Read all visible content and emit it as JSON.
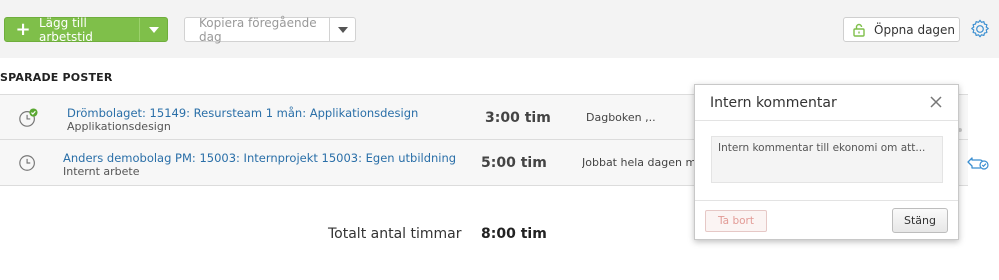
{
  "toolbar": {
    "add_label": "Lägg till arbetstid",
    "copy_label": "Kopiera föregående dag",
    "open_label": "Öppna dagen"
  },
  "section_title": "SPARADE POSTER",
  "entries": [
    {
      "title": "Drömbolaget: 15149: Resursteam 1 mån: Applikationsdesign",
      "subtitle": "Applikationsdesign",
      "hours": "3:00 tim",
      "note": "Dagboken ,..",
      "status": "completed"
    },
    {
      "title": "Anders demobolag PM: 15003: Internprojekt 15003: Egen utbildning",
      "subtitle": "Internt arbete",
      "hours": "5:00 tim",
      "note": "Jobbat hela dagen med",
      "status": "pending"
    }
  ],
  "totals": {
    "label": "Totalt antal timmar",
    "value": "8:00 tim"
  },
  "popup": {
    "title": "Intern kommentar",
    "comment": "Intern kommentar till ekonomi om att...",
    "delete_label": "Ta bort",
    "close_label": "Stäng"
  },
  "colors": {
    "accent_green": "#7fbf4a",
    "link_blue": "#2a6fa8",
    "danger_soft": "#e29b96"
  }
}
